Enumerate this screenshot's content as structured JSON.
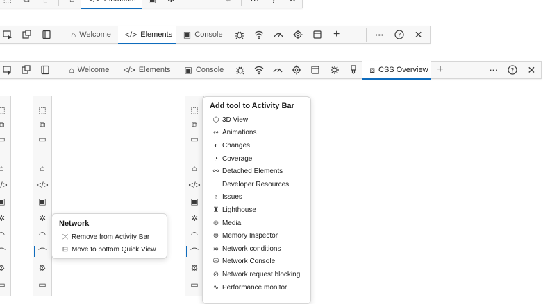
{
  "toolbar1": {
    "tabs": [
      {
        "label": "Welcome",
        "icon": "home-icon"
      },
      {
        "label": "Elements",
        "icon": "code-icon",
        "active": true
      },
      {
        "label": "Console",
        "icon": "console-icon"
      }
    ]
  },
  "toolbar2": {
    "tabs": [
      {
        "label": "Welcome",
        "icon": "home-icon"
      },
      {
        "label": "Elements",
        "icon": "code-icon"
      },
      {
        "label": "Console",
        "icon": "console-icon"
      },
      {
        "label": "CSS Overview",
        "icon": "css-overview-icon",
        "active": true
      }
    ]
  },
  "network_menu": {
    "title": "Network",
    "items": [
      {
        "label": "Remove from Activity Bar",
        "icon": "remove-icon"
      },
      {
        "label": "Move to bottom Quick View",
        "icon": "move-icon"
      }
    ]
  },
  "add_tool_menu": {
    "title": "Add tool to Activity Bar",
    "items": [
      {
        "label": "3D View",
        "icon": "cube-icon"
      },
      {
        "label": "Animations",
        "icon": "animations-icon"
      },
      {
        "label": "Changes",
        "icon": "changes-icon"
      },
      {
        "label": "Coverage",
        "icon": "coverage-icon"
      },
      {
        "label": "Detached Elements",
        "icon": "detached-icon"
      },
      {
        "label": "Developer Resources",
        "icon": ""
      },
      {
        "label": "Issues",
        "icon": "issues-icon"
      },
      {
        "label": "Lighthouse",
        "icon": "lighthouse-icon"
      },
      {
        "label": "Media",
        "icon": "media-icon"
      },
      {
        "label": "Memory Inspector",
        "icon": "memory-icon"
      },
      {
        "label": "Network conditions",
        "icon": "network-conditions-icon"
      },
      {
        "label": "Network Console",
        "icon": "network-console-icon"
      },
      {
        "label": "Network request blocking",
        "icon": "blocking-icon"
      },
      {
        "label": "Performance monitor",
        "icon": "performance-icon"
      }
    ]
  },
  "colors": {
    "accent": "#0f6cbd",
    "toolbar_bg": "#f7f7f7",
    "border": "#d6d6d6"
  }
}
